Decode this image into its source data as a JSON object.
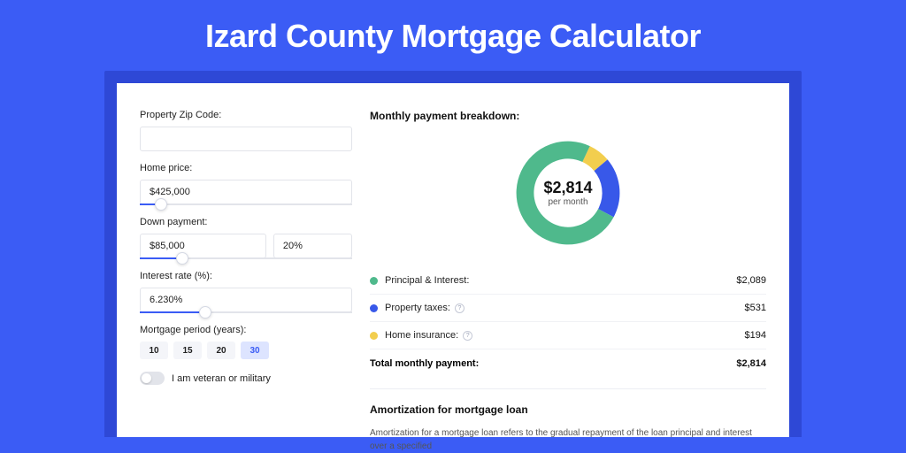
{
  "title": "Izard County Mortgage Calculator",
  "form": {
    "zip_label": "Property Zip Code:",
    "zip_value": "",
    "home_price_label": "Home price:",
    "home_price_value": "$425,000",
    "home_price_slider_pct": 10,
    "down_payment_label": "Down payment:",
    "down_payment_value": "$85,000",
    "down_payment_pct": "20%",
    "down_payment_slider_pct": 20,
    "interest_label": "Interest rate (%):",
    "interest_value": "6.230%",
    "interest_slider_pct": 31,
    "period_label": "Mortgage period (years):",
    "period_options": [
      "10",
      "15",
      "20",
      "30"
    ],
    "period_selected": "30",
    "veteran_label": "I am veteran or military"
  },
  "breakdown": {
    "title": "Monthly payment breakdown:",
    "center_value": "$2,814",
    "center_sub": "per month",
    "items": [
      {
        "label": "Principal & Interest:",
        "value": "$2,089",
        "color": "#4fb98c",
        "pct": 74.2,
        "info": false
      },
      {
        "label": "Property taxes:",
        "value": "$531",
        "color": "#3858e9",
        "pct": 18.9,
        "info": true
      },
      {
        "label": "Home insurance:",
        "value": "$194",
        "color": "#f2ce4e",
        "pct": 6.9,
        "info": true
      }
    ],
    "total_label": "Total monthly payment:",
    "total_value": "$2,814"
  },
  "amortization": {
    "title": "Amortization for mortgage loan",
    "text": "Amortization for a mortgage loan refers to the gradual repayment of the loan principal and interest over a specified"
  },
  "chart_data": {
    "type": "pie",
    "title": "Monthly payment breakdown",
    "series": [
      {
        "name": "Principal & Interest",
        "value": 2089,
        "color": "#4fb98c"
      },
      {
        "name": "Property taxes",
        "value": 531,
        "color": "#3858e9"
      },
      {
        "name": "Home insurance",
        "value": 194,
        "color": "#f2ce4e"
      }
    ],
    "total": 2814,
    "unit": "USD/month"
  }
}
